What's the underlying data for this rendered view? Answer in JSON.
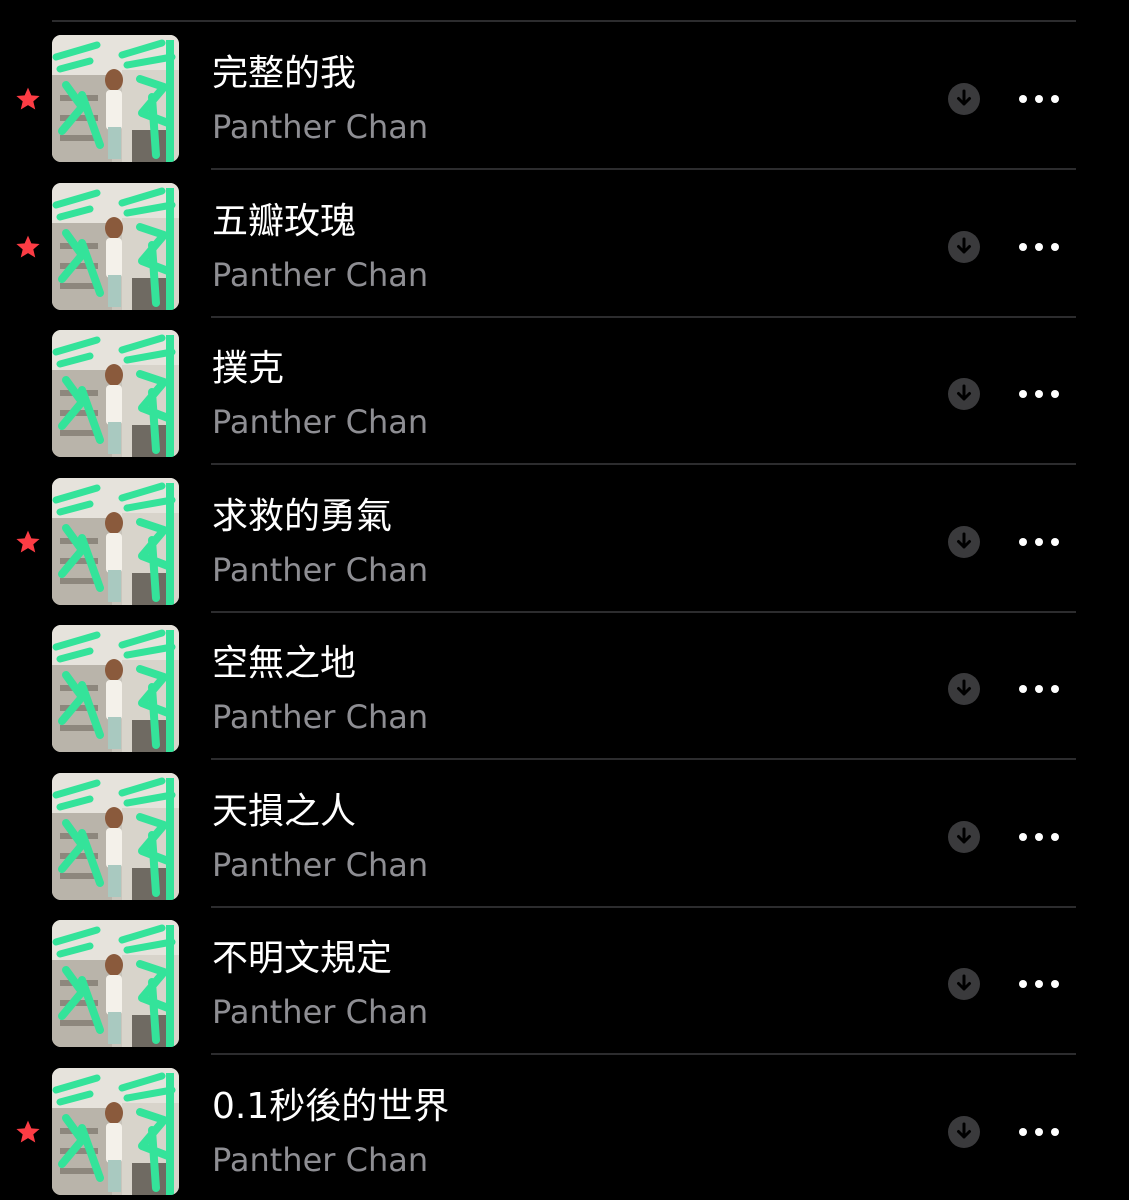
{
  "accent_color": "#fc3c44",
  "songs": [
    {
      "title": "完整的我",
      "artist": "Panther Chan",
      "favorited": true
    },
    {
      "title": "五瓣玫瑰",
      "artist": "Panther Chan",
      "favorited": true
    },
    {
      "title": "撲克",
      "artist": "Panther Chan",
      "favorited": false
    },
    {
      "title": "求救的勇氣",
      "artist": "Panther Chan",
      "favorited": true
    },
    {
      "title": "空無之地",
      "artist": "Panther Chan",
      "favorited": false
    },
    {
      "title": "天損之人",
      "artist": "Panther Chan",
      "favorited": false
    },
    {
      "title": "不明文規定",
      "artist": "Panther Chan",
      "favorited": false
    },
    {
      "title": "0.1秒後的世界",
      "artist": "Panther Chan",
      "favorited": true
    }
  ],
  "icons": {
    "favorite": "star-icon",
    "download": "download-icon",
    "more": "more-icon",
    "artwork": "album-artwork"
  }
}
